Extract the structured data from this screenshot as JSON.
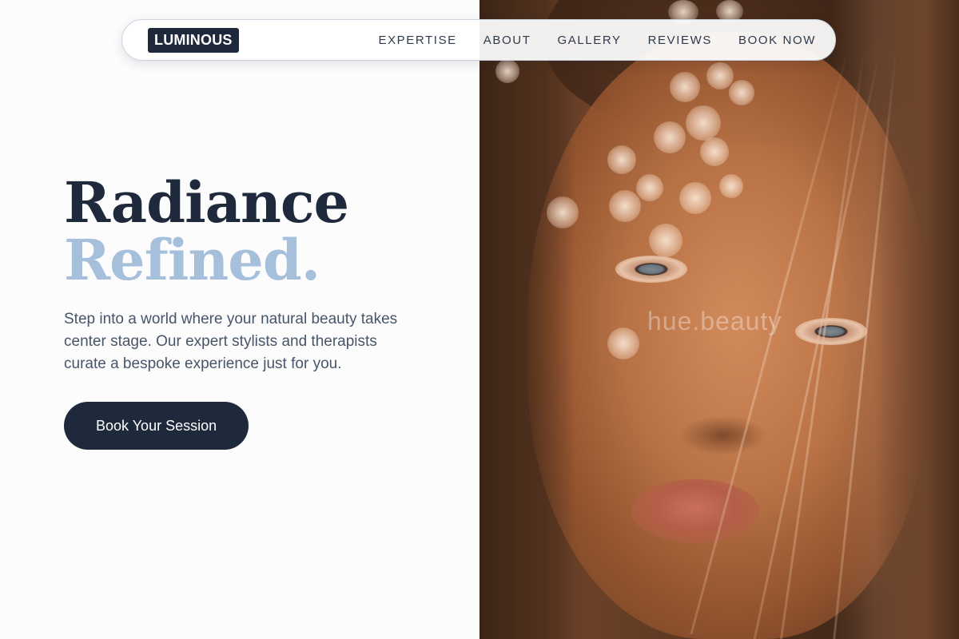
{
  "brand": {
    "logo_text": "LUMINOUS"
  },
  "nav": {
    "items": [
      {
        "label": "EXPERTISE"
      },
      {
        "label": "ABOUT"
      },
      {
        "label": "GALLERY"
      },
      {
        "label": "REVIEWS"
      },
      {
        "label": "BOOK NOW"
      }
    ]
  },
  "hero": {
    "title_line_1": "Radiance",
    "title_line_2": "Refined.",
    "description": "Step into a world where your natural beauty takes center stage. Our expert stylists and therapists curate a bespoke experience just for you.",
    "cta_label": "Book Your Session"
  },
  "photo": {
    "watermark": "hue.beauty"
  },
  "colors": {
    "navy": "#1e293b",
    "accent_blue": "#a6bfdb",
    "body_text": "#475569",
    "background": "#fcfcfd"
  }
}
